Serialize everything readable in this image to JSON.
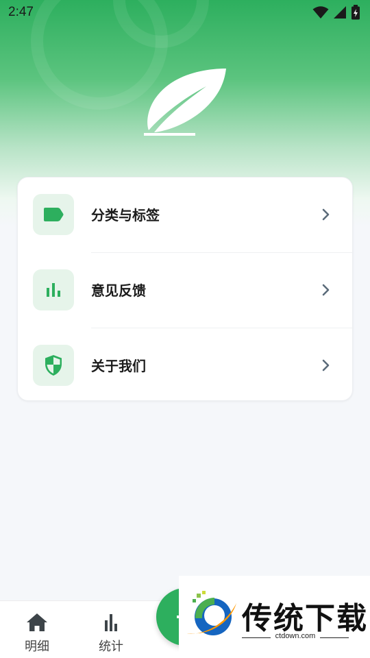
{
  "status_bar": {
    "time": "2:47"
  },
  "colors": {
    "accent": "#2daf5e",
    "icon_bg": "#e6f4ea",
    "chevron": "#5b6b7a"
  },
  "menu": {
    "items": [
      {
        "label": "分类与标签",
        "icon": "tag-icon"
      },
      {
        "label": "意见反馈",
        "icon": "bar-chart-icon"
      },
      {
        "label": "关于我们",
        "icon": "shield-icon"
      }
    ]
  },
  "bottom_nav": {
    "items": [
      {
        "label": "明细",
        "icon": "home-icon"
      },
      {
        "label": "统计",
        "icon": "bar-chart-icon"
      }
    ],
    "fab_icon": "plus-icon"
  },
  "watermark": {
    "title": "传统下载",
    "subtitle": "ctdown.com"
  }
}
